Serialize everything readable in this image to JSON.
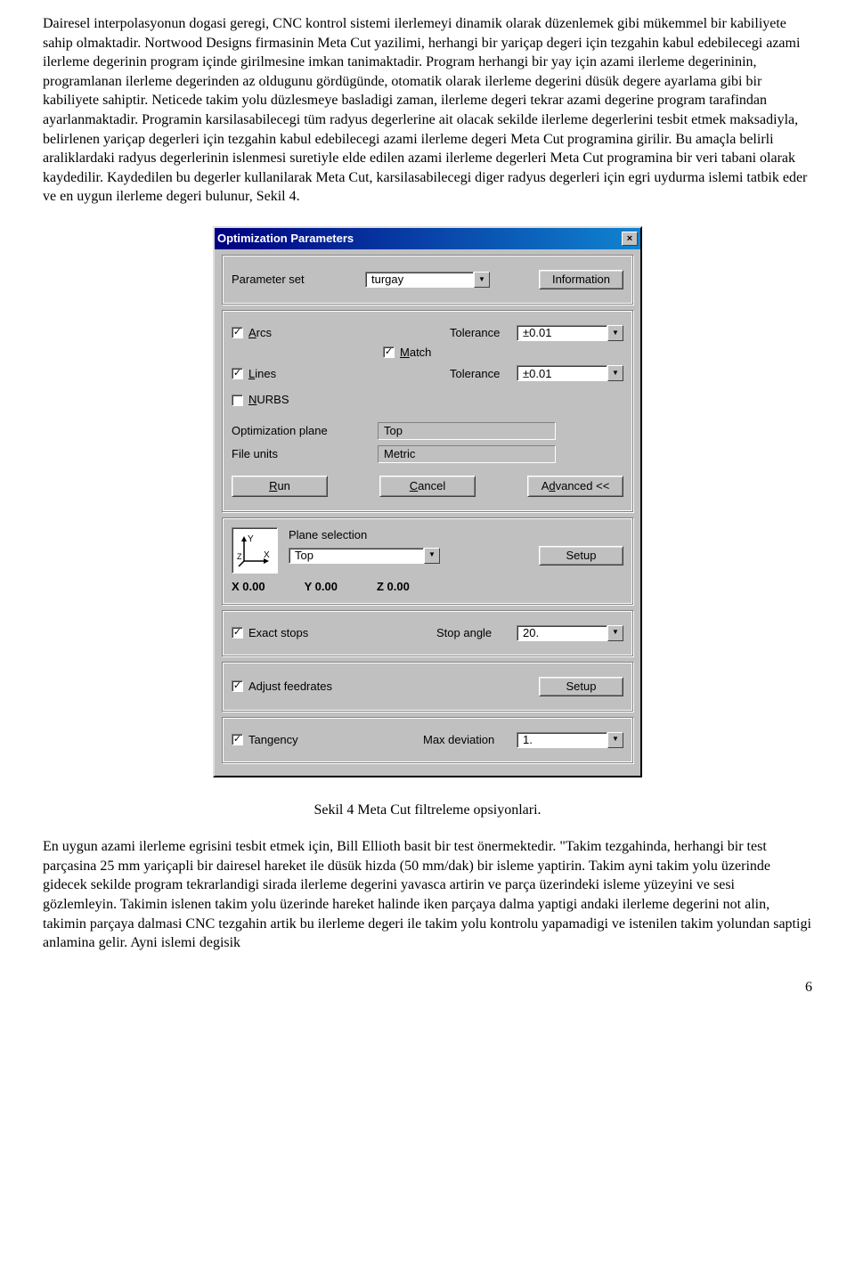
{
  "paragraphs": {
    "p1": "Dairesel interpolasyonun dogasi geregi, CNC kontrol sistemi ilerlemeyi dinamik olarak düzenlemek gibi mükemmel bir kabiliyete sahip olmaktadir. Nortwood Designs firmasinin Meta Cut yazilimi, herhangi bir yariçap degeri için tezgahin kabul edebilecegi azami ilerleme degerinin program içinde girilmesine imkan tanimaktadir. Program herhangi bir yay için azami ilerleme degerininin, programlanan ilerleme degerinden az oldugunu gördügünde, otomatik olarak ilerleme degerini düsük degere ayarlama gibi bir kabiliyete sahiptir. Neticede takim yolu düzlesmeye basladigi zaman, ilerleme degeri tekrar azami degerine program tarafindan ayarlanmaktadir. Programin karsilasabilecegi tüm radyus degerlerine ait olacak sekilde ilerleme degerlerini tesbit etmek maksadiyla, belirlenen yariçap degerleri için tezgahin kabul edebilecegi azami ilerleme degeri Meta Cut programina girilir. Bu amaçla belirli araliklardaki radyus degerlerinin islenmesi suretiyle elde edilen azami ilerleme degerleri Meta Cut programina bir veri tabani olarak kaydedilir. Kaydedilen bu degerler kullanilarak Meta Cut, karsilasabilecegi diger radyus degerleri için egri uydurma islemi tatbik eder ve en uygun ilerleme degeri bulunur, Sekil 4.",
    "caption": "Sekil 4 Meta Cut filtreleme opsiyonlari.",
    "p2": "En uygun azami ilerleme egrisini tesbit etmek için, Bill Ellioth basit bir test önermektedir. \"Takim tezgahinda, herhangi bir test parçasina 25 mm yariçapli bir dairesel hareket ile düsük hizda (50 mm/dak) bir isleme yaptirin. Takim ayni takim yolu üzerinde gidecek sekilde program tekrarlandigi sirada ilerleme degerini yavasca artirin ve parça üzerindeki isleme yüzeyini ve sesi gözlemleyin. Takimin islenen takim yolu üzerinde hareket halinde iken parçaya dalma yaptigi andaki ilerleme degerini not alin, takimin parçaya dalmasi CNC tezgahin artik bu ilerleme degeri ile takim yolu kontrolu yapamadigi ve istenilen takim yolundan saptigi anlamina gelir. Ayni islemi degisik"
  },
  "dialog": {
    "title": "Optimization Parameters",
    "close": "×",
    "param_set_label": "Parameter set",
    "param_set_value": "turgay",
    "information_btn": "Information",
    "arcs_label": "Arcs",
    "match_label": "Match",
    "lines_label": "Lines",
    "nurbs_label": "NURBS",
    "tolerance_label": "Tolerance",
    "tolerance_arcs": "±0.01",
    "tolerance_lines": "±0.01",
    "opt_plane_label": "Optimization plane",
    "opt_plane_value": "Top",
    "file_units_label": "File units",
    "file_units_value": "Metric",
    "run_btn": "Run",
    "cancel_btn": "Cancel",
    "advanced_btn": "Advanced <<",
    "plane_selection_label": "Plane selection",
    "plane_selection_value": "Top",
    "setup_btn": "Setup",
    "coord_x": "X 0.00",
    "coord_y": "Y 0.00",
    "coord_z": "Z 0.00",
    "exact_stops_label": "Exact stops",
    "stop_angle_label": "Stop angle",
    "stop_angle_value": "20.",
    "adjust_feedrates_label": "Adjust feedrates",
    "tangency_label": "Tangency",
    "max_dev_label": "Max deviation",
    "max_dev_value": "1.",
    "check_on": "✓",
    "y_axis": "Y",
    "x_axis": "X",
    "z_axis": "Z"
  },
  "page_number": "6"
}
